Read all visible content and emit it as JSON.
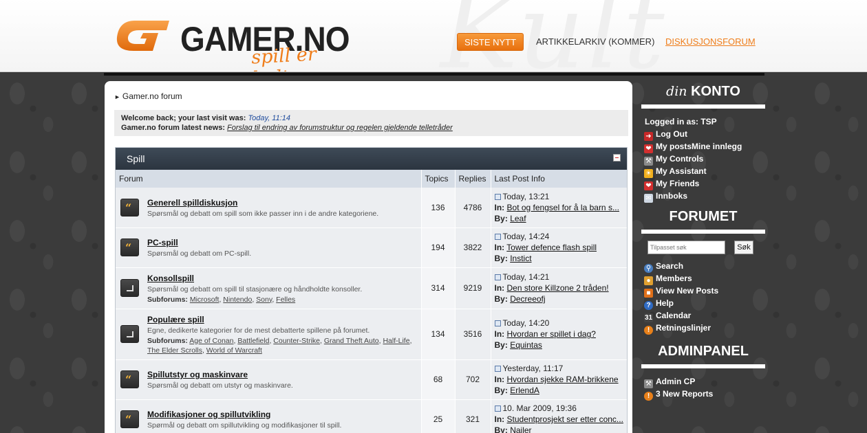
{
  "header": {
    "logo_text": "GAMER.NO",
    "logo_tagline": "spill er kultur",
    "watermark": "Kult",
    "nav": {
      "siste": "SISTE NYTT",
      "arkiv": "ARTIKKELARKIV (KOMMER)",
      "forum": "DISKUSJONSFORUM"
    }
  },
  "breadcrumb": "Gamer.no forum",
  "welcome": {
    "line1_label": "Welcome back; your last visit was:",
    "last_visit": "Today, 11:14",
    "line2_label": "Gamer.no forum latest news:",
    "news_link": "Forslag til endring av forumstruktur og regelen gjeldende telletråder"
  },
  "category": {
    "title": "Spill",
    "columns": {
      "forum": "Forum",
      "topics": "Topics",
      "replies": "Replies",
      "last": "Last Post Info"
    },
    "forums": [
      {
        "title": "Generell spilldiskusjon",
        "desc": "Spørsmål og debatt om spill som ikke passer inn i de andre kategoriene.",
        "icon": "new-posts-icon",
        "topics": "136",
        "replies": "4786",
        "last_date": "Today, 13:21",
        "last_in": "Bot og fengsel for å la barn s...",
        "last_by": "Leaf"
      },
      {
        "title": "PC-spill",
        "desc": "Spørsmål og debatt om PC-spill.",
        "icon": "new-posts-icon",
        "topics": "194",
        "replies": "3822",
        "last_date": "Today, 14:24",
        "last_in": "Tower defence flash spill",
        "last_by": "Instict"
      },
      {
        "title": "Konsollspill",
        "desc": "Spørsmål og debatt om spill til stasjonære og håndholdte konsoller.",
        "icon": "subforum-icon",
        "subforums_label": "Subforums:",
        "subforums": [
          "Microsoft",
          "Nintendo",
          "Sony",
          "Felles"
        ],
        "topics": "314",
        "replies": "9219",
        "last_date": "Today, 14:21",
        "last_in": "Den store Killzone 2 tråden!",
        "last_by": "Decreeofj"
      },
      {
        "title": "Populære spill",
        "desc": "Egne, dedikerte kategorier for de mest debatterte spillene på forumet.",
        "icon": "subforum-icon",
        "subforums_label": "Subforums:",
        "subforums": [
          "Age of Conan",
          "Battlefield",
          "Counter-Strike",
          "Grand Theft Auto",
          "Half-Life",
          "The Elder Scrolls",
          "World of Warcraft"
        ],
        "topics": "134",
        "replies": "3516",
        "last_date": "Today, 14:20",
        "last_in": "Hvordan er spillet i dag?",
        "last_by": "Equintas"
      },
      {
        "title": "Spillutstyr og maskinvare",
        "desc": "Spørsmål og debatt om utstyr og maskinvare.",
        "icon": "new-posts-icon",
        "topics": "68",
        "replies": "702",
        "last_date": "Yesterday, 11:17",
        "last_in": "Hvordan sjekke RAM-brikkene",
        "last_by": "ErlendA"
      },
      {
        "title": "Modifikasjoner og spillutvikling",
        "desc": "Spørmål og debatt om spillutvikling og modifikasjoner til spill.",
        "icon": "new-posts-icon",
        "topics": "25",
        "replies": "321",
        "last_date": "10. Mar 2009, 19:36",
        "last_in": "Studentprosjekt ser etter conc...",
        "last_by": "Nailer"
      }
    ],
    "in_label": "In:",
    "by_label": "By:"
  },
  "sidebar": {
    "konto_title_prefix": "din",
    "konto_title": "KONTO",
    "logged_in": "Logged in as: TSP",
    "konto_items": [
      {
        "label": "Log Out",
        "icon": "logout-icon",
        "color": "#c62828"
      },
      {
        "label": "My postsMine innlegg",
        "icon": "heart-icon",
        "color": "#d32f2f"
      },
      {
        "label": "My Controls",
        "icon": "tools-icon",
        "color": "#8a8a8a"
      },
      {
        "label": "My Assistant",
        "icon": "sun-icon",
        "color": "#f2b01e"
      },
      {
        "label": "My Friends",
        "icon": "heart-icon",
        "color": "#d32f2f"
      },
      {
        "label": "Innboks",
        "icon": "mail-icon",
        "color": "#cfd8e3"
      }
    ],
    "forum_title": "FORUMET",
    "search_placeholder": "Tilpasset søk",
    "search_button": "Søk",
    "forum_items": [
      {
        "label": "Search",
        "icon": "search-icon",
        "color": "#4a7fc1"
      },
      {
        "label": "Members",
        "icon": "members-icon",
        "color": "#e0a030"
      },
      {
        "label": "View New Posts",
        "icon": "new-posts-icon",
        "color": "#e0701a"
      },
      {
        "label": "Help",
        "icon": "help-icon",
        "color": "#2f6bc4"
      },
      {
        "label": "Calendar",
        "icon": "calendar-icon",
        "color": "#444"
      },
      {
        "label": "Retningslinjer",
        "icon": "alert-icon",
        "color": "#e8801a"
      }
    ],
    "admin_title": "ADMINPANEL",
    "admin_items": [
      {
        "label": "Admin CP",
        "icon": "tools-icon",
        "color": "#8a8a8a"
      },
      {
        "label": "3 New Reports",
        "icon": "alert-icon",
        "color": "#e8801a"
      }
    ]
  }
}
